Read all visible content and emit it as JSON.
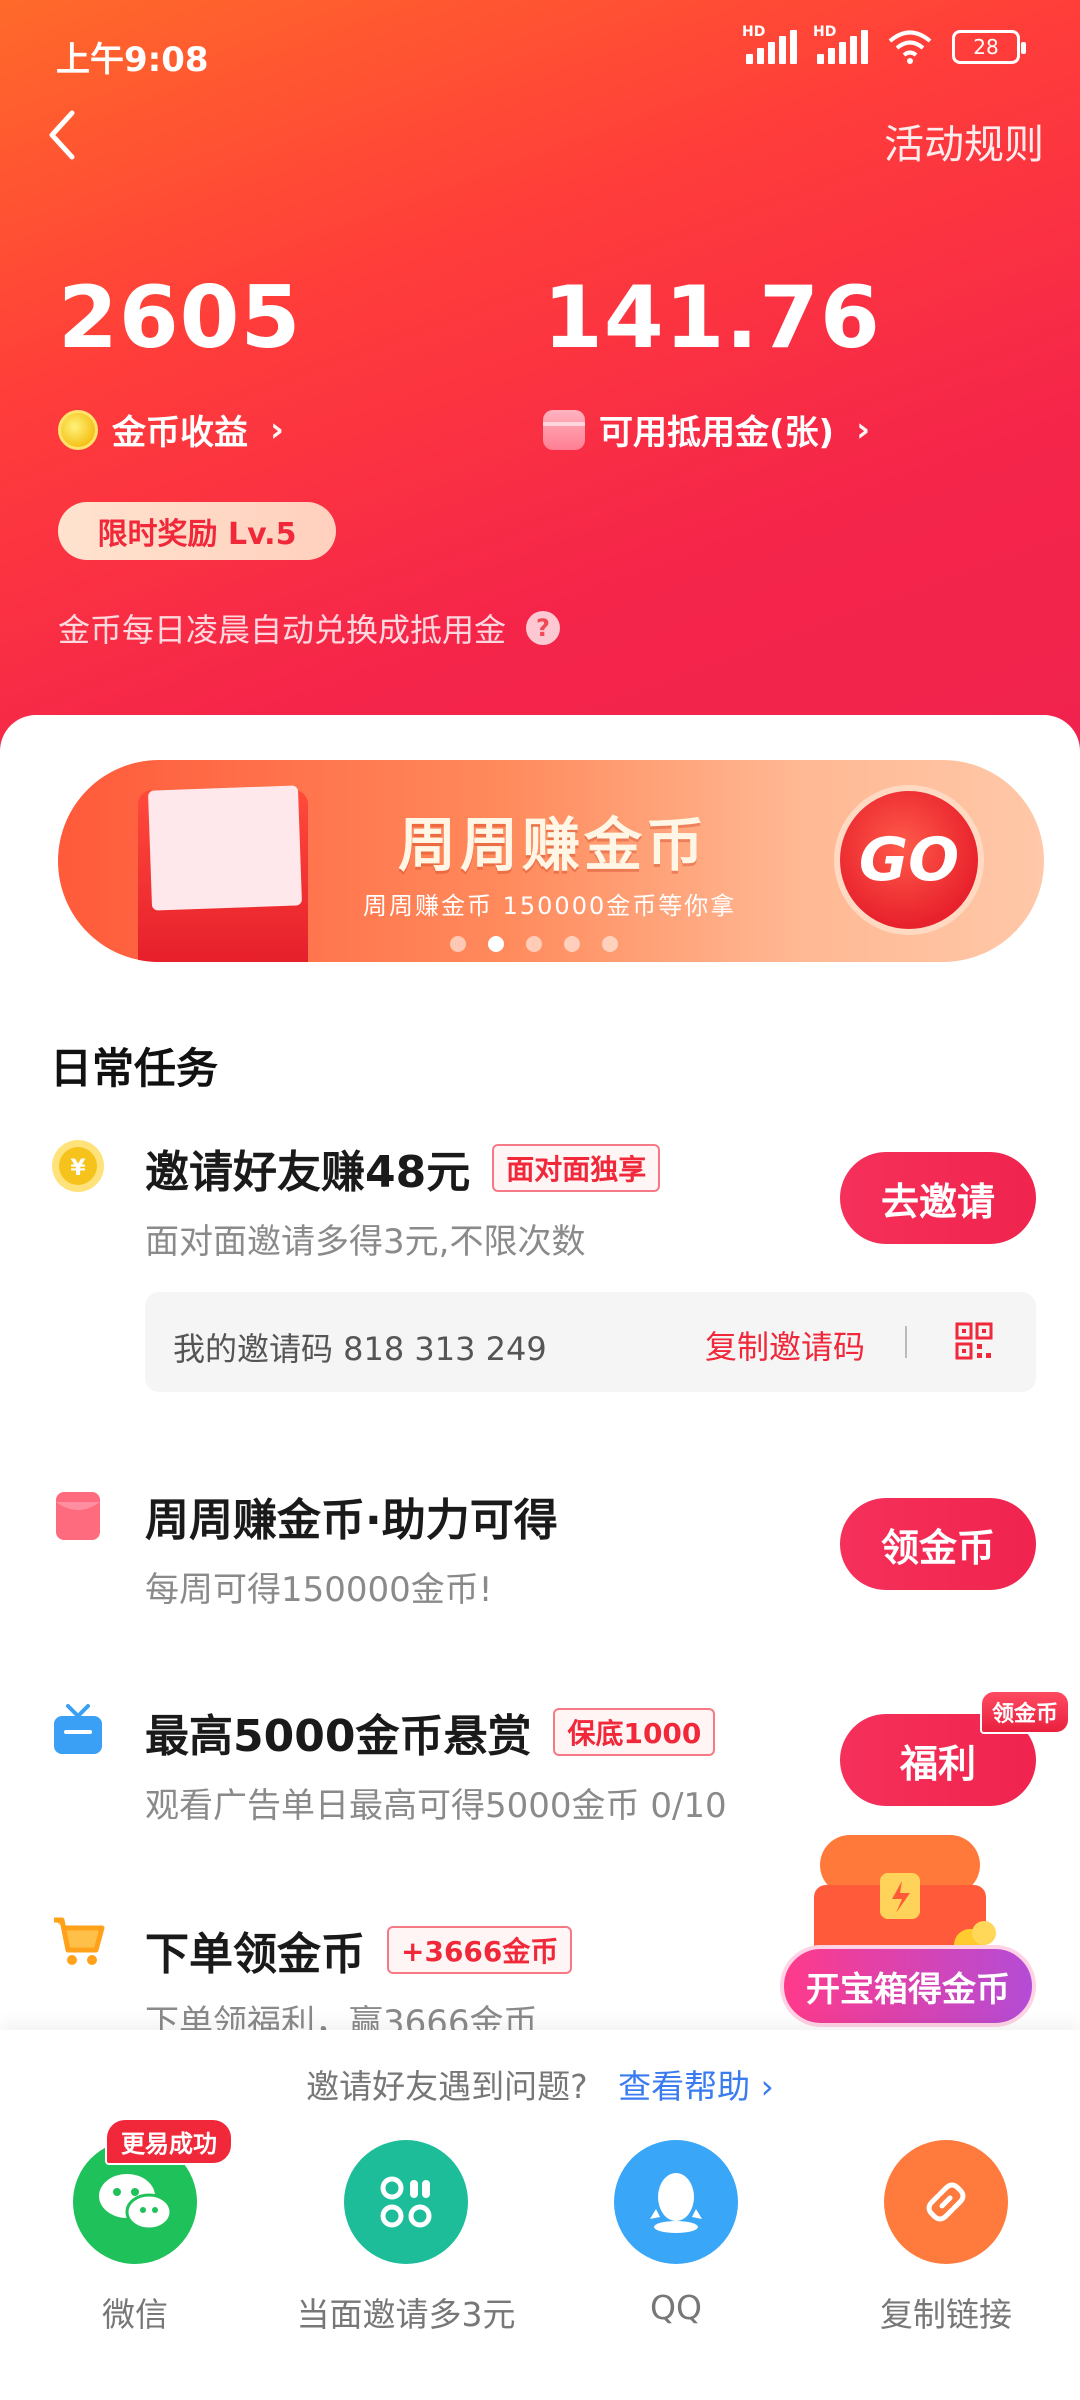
{
  "status_bar": {
    "time": "上午9:08",
    "battery": "28",
    "network_label": "HD"
  },
  "header": {
    "rules_label": "活动规则",
    "coins": {
      "value": "2605",
      "label": "金币收益"
    },
    "voucher": {
      "value": "141.76",
      "label": "可用抵用金(张)"
    },
    "level_badge": "限时奖励 Lv.5",
    "note": "金币每日凌晨自动兑换成抵用金",
    "help_mark": "?"
  },
  "banner": {
    "title": "周周赚金币",
    "subtitle": "周周赚金币 150000金币等你拿",
    "go_label": "GO",
    "slide_count": 5,
    "active_slide": 2
  },
  "daily_tasks": {
    "title": "日常任务",
    "tasks": [
      {
        "title": "邀请好友赚48元",
        "tag": "面对面独享",
        "desc": "面对面邀请多得3元,不限次数",
        "button": "去邀请",
        "invite_code_label": "我的邀请码 818 313 249",
        "copy_label": "复制邀请码"
      },
      {
        "title": "周周赚金币·助力可得",
        "tag": "",
        "desc": "每周可得150000金币!",
        "button": "领金币"
      },
      {
        "title": "最高5000金币悬赏",
        "tag": "保底1000",
        "desc": "观看广告单日最高可得5000金币 0/10",
        "button": "福利",
        "badge": "领金币"
      },
      {
        "title": "下单领金币",
        "tag": "+3666金币",
        "desc": "下单领福利，赢3666金币"
      }
    ]
  },
  "treasure": {
    "label": "开宝箱得金币"
  },
  "share_panel": {
    "help_text": "邀请好友遇到问题?",
    "help_link": "查看帮助",
    "easy_badge": "更易成功",
    "items": [
      {
        "label": "微信",
        "color": "#1fc15a"
      },
      {
        "label": "当面邀请多3元",
        "color": "#1dbd9a"
      },
      {
        "label": "QQ",
        "color": "#39a6f7"
      },
      {
        "label": "复制链接",
        "color": "#ff7a3d"
      }
    ]
  },
  "colors": {
    "primary_red": "#f0244e",
    "header_orange": "#ff6a2a",
    "link_blue": "#3a7cf0"
  }
}
